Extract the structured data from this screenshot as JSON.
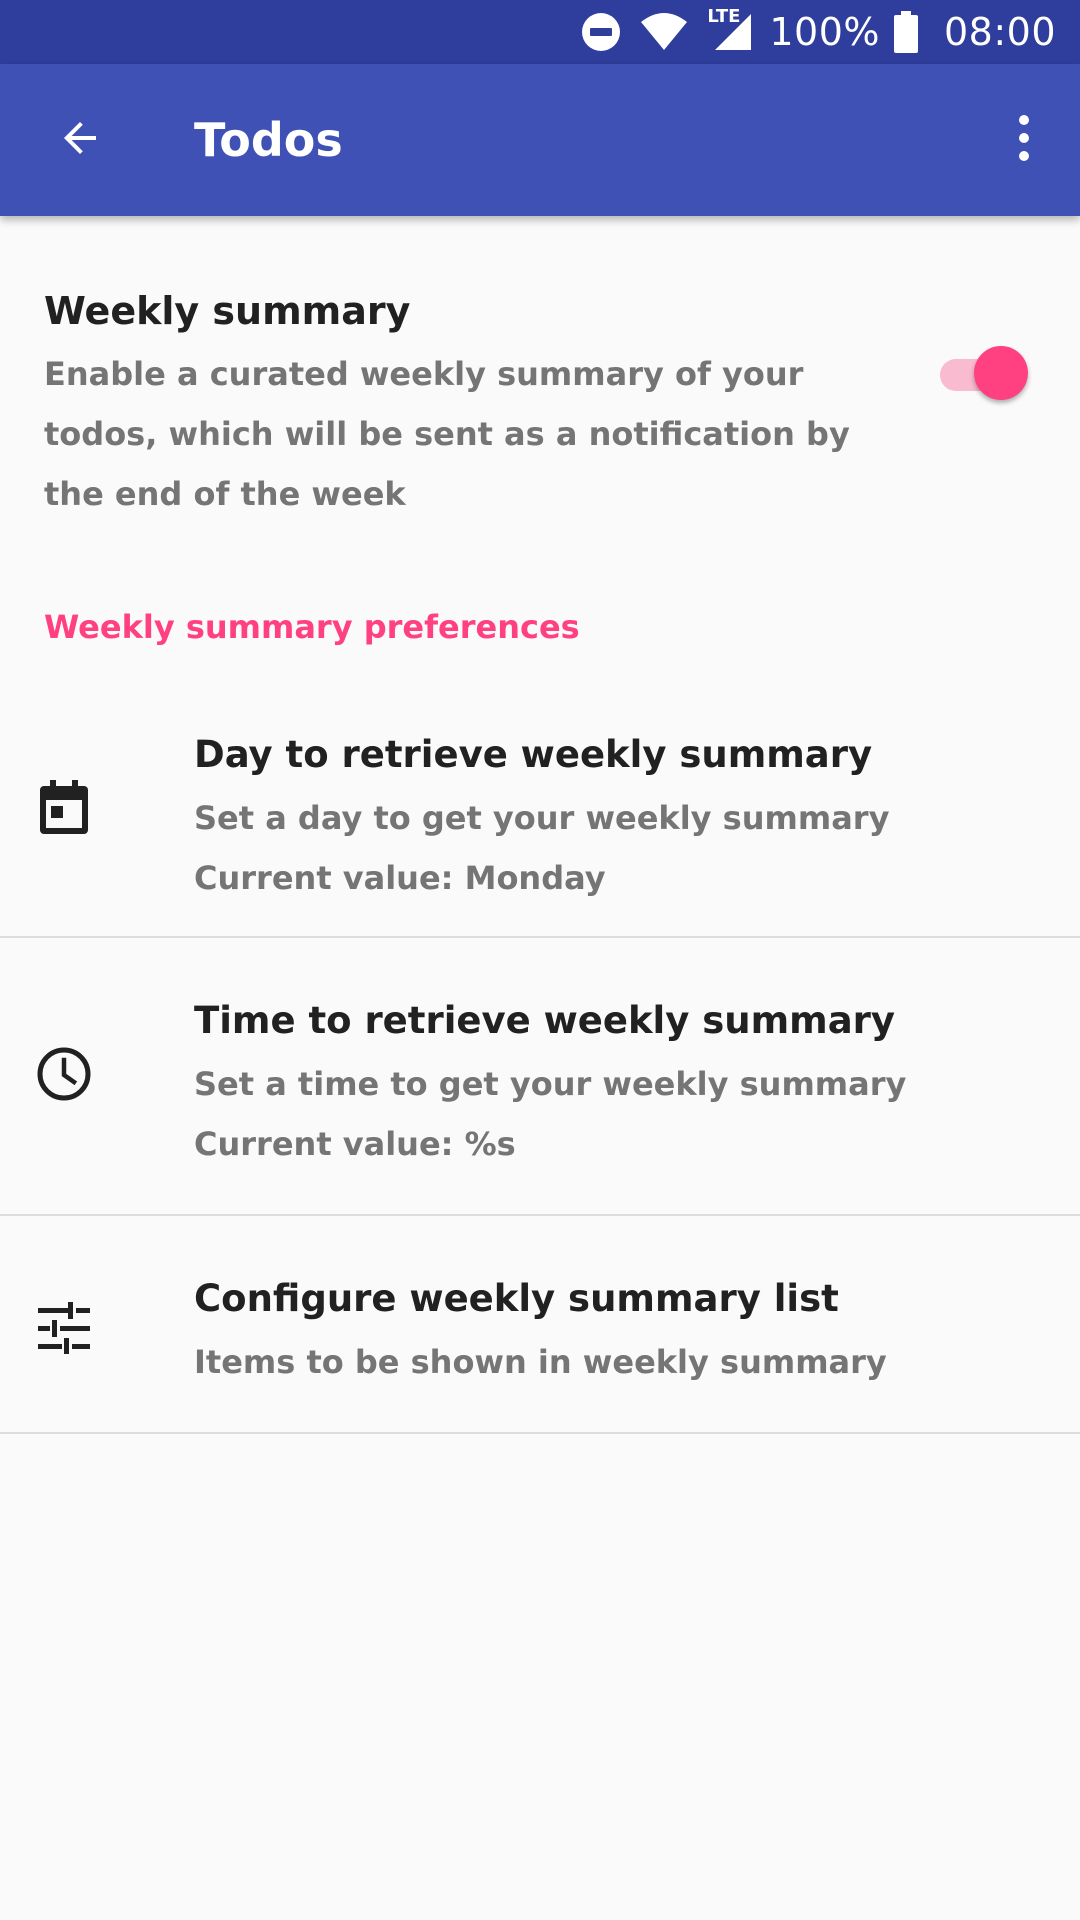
{
  "status_bar": {
    "battery": "100%",
    "time": "08:00",
    "network": "LTE",
    "icons": [
      "do-not-disturb-icon",
      "wifi-icon",
      "signal-icon",
      "battery-icon"
    ]
  },
  "app_bar": {
    "title": "Todos",
    "back_icon": "arrow-back-icon",
    "menu_icon": "more-vert-icon",
    "color": "#3f51b5"
  },
  "weekly_summary": {
    "title": "Weekly summary",
    "description": "Enable a curated weekly summary of your todos, which will be sent as a notification by the end of the week",
    "enabled": true,
    "accent": "#ff4081"
  },
  "category": {
    "label": "Weekly summary preferences"
  },
  "preferences": [
    {
      "icon": "calendar-icon",
      "title": "Day to retrieve weekly summary",
      "summary": "Set a day to get your weekly summary",
      "value": "Current value: Monday"
    },
    {
      "icon": "clock-icon",
      "title": "Time to retrieve weekly summary",
      "summary": "Set a time to get your weekly summary",
      "value": "Current value: %s"
    },
    {
      "icon": "tune-icon",
      "title": "Configure weekly summary list",
      "summary": "Items to be shown in weekly summary"
    }
  ]
}
